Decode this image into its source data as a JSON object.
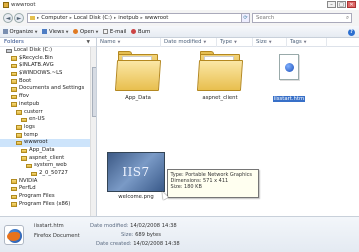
{
  "window": {
    "title": "wwwroot",
    "minimize": "–",
    "maximize": "□",
    "close": "✕"
  },
  "address": {
    "segments": [
      "Computer",
      "Local Disk (C:)",
      "inetpub",
      "wwwroot"
    ],
    "separator": "▸",
    "search_placeholder": "Search",
    "refresh": "⟳"
  },
  "nav_buttons": {
    "back": "◄",
    "forward": "►"
  },
  "toolbar": {
    "organize": "Organize",
    "views": "Views",
    "open": "Open",
    "email": "E-mail",
    "burn": "Burn",
    "help": "?"
  },
  "nav_pane": {
    "header": "Folders",
    "items": [
      {
        "label": "Local Disk (C:)",
        "indent": 2,
        "type": "drive"
      },
      {
        "label": "$Recycle.Bin",
        "indent": 3,
        "type": "folder"
      },
      {
        "label": "$INLATB.AVG",
        "indent": 3,
        "type": "folder"
      },
      {
        "label": "$WINDOWS.~LS",
        "indent": 3,
        "type": "folder"
      },
      {
        "label": "Boot",
        "indent": 3,
        "type": "folder"
      },
      {
        "label": "Documents and Settings",
        "indent": 3,
        "type": "folder"
      },
      {
        "label": "ffov",
        "indent": 3,
        "type": "folder"
      },
      {
        "label": "inetpub",
        "indent": 3,
        "type": "folder"
      },
      {
        "label": "custerr",
        "indent": 4,
        "type": "folder"
      },
      {
        "label": "en-US",
        "indent": 5,
        "type": "folder"
      },
      {
        "label": "logs",
        "indent": 4,
        "type": "folder"
      },
      {
        "label": "temp",
        "indent": 4,
        "type": "folder"
      },
      {
        "label": "wwwroot",
        "indent": 4,
        "type": "folder",
        "selected": true
      },
      {
        "label": "App_Data",
        "indent": 5,
        "type": "folder"
      },
      {
        "label": "aspnet_client",
        "indent": 5,
        "type": "folder"
      },
      {
        "label": "system_web",
        "indent": 6,
        "type": "folder"
      },
      {
        "label": "2_0_50727",
        "indent": 7,
        "type": "folder"
      },
      {
        "label": "NVIDIA",
        "indent": 3,
        "type": "folder"
      },
      {
        "label": "PerfLd",
        "indent": 3,
        "type": "folder"
      },
      {
        "label": "Program Files",
        "indent": 3,
        "type": "folder"
      },
      {
        "label": "Program Files (x86)",
        "indent": 3,
        "type": "folder"
      }
    ]
  },
  "columns": [
    "Name",
    "Date modified",
    "Type",
    "Size",
    "Tags"
  ],
  "files": [
    {
      "name": "App_Data",
      "kind": "folder"
    },
    {
      "name": "aspnet_client",
      "kind": "folder"
    },
    {
      "name": "iisstart.htm",
      "kind": "htm",
      "selected": true
    },
    {
      "name": "welcome.png",
      "kind": "png",
      "thumb_text": "IIS7"
    }
  ],
  "tooltip": {
    "type_line": "Type: Portable Network Graphics",
    "dimensions_line": "Dimensions: 571 x 411",
    "size_line": "Size: 180 KB"
  },
  "details": {
    "name": "iisstart.htm",
    "type": "Firefox Document",
    "date_modified_label": "Date modified:",
    "date_modified": "14/02/2008 14:38",
    "size_label": "Size:",
    "size": "689 bytes",
    "date_created_label": "Date created:",
    "date_created": "14/02/2008 14:38"
  }
}
